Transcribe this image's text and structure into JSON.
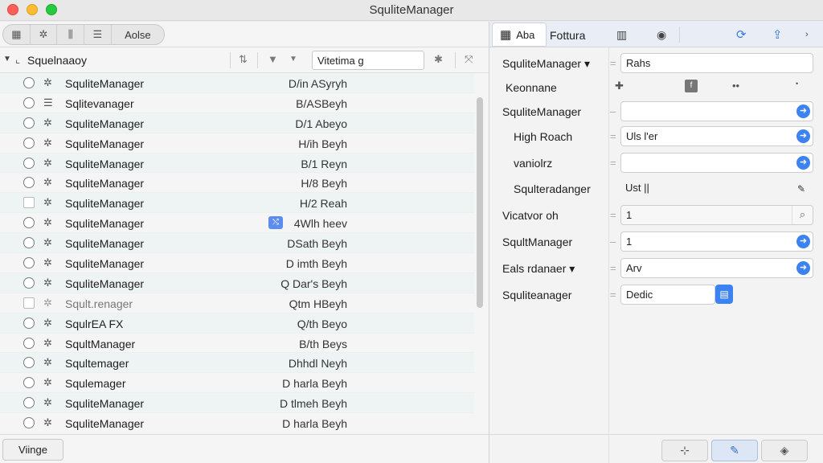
{
  "window": {
    "title": "SquliteManager"
  },
  "left_toolbar": {
    "buttons": [
      {
        "icon": "database-icon",
        "glyph": "▦"
      },
      {
        "icon": "tools-icon",
        "glyph": "✲"
      },
      {
        "icon": "columns-icon",
        "glyph": "⫼"
      },
      {
        "icon": "list-icon",
        "glyph": "☰"
      }
    ],
    "label": "Aolse"
  },
  "tree_header": {
    "label": "Squelnaaoy",
    "search_value": "Vitetima g"
  },
  "rows": [
    {
      "name": "SquliteManager",
      "value": "D/in ASyryh"
    },
    {
      "name": "Sqlitevanager",
      "value": "B/ASBeyh"
    },
    {
      "name": "SquliteManager",
      "value": "D/1 Abeyo"
    },
    {
      "name": "SquliteManager",
      "value": "H/ih Beyh"
    },
    {
      "name": "SquliteManager",
      "value": "B/1 Reyn"
    },
    {
      "name": "SquliteManager",
      "value": "H/8 Beyh"
    },
    {
      "name": "SquliteManager",
      "value": "H/2 Reah"
    },
    {
      "name": "SquliteManager",
      "value": "4Wlh heev"
    },
    {
      "name": "SquliteManager",
      "value": "DSath Beyh"
    },
    {
      "name": "SquliteManager",
      "value": "D imth Beyh"
    },
    {
      "name": "SquliteManager",
      "value": "Q Dar's Beyh"
    },
    {
      "name": "Sqult.renager",
      "value": "Qtm HBeyh"
    },
    {
      "name": "SqulrEA FX",
      "value": "Q/th Beyo"
    },
    {
      "name": "SqultManager",
      "value": "B/th Beys"
    },
    {
      "name": "Squltemager",
      "value": "Dhhdl Neyh"
    },
    {
      "name": "Squlemager",
      "value": "D harla Beyh"
    },
    {
      "name": "SquliteManager",
      "value": "D tlmeh Beyh"
    },
    {
      "name": "SquliteManager",
      "value": "D harla Beyh"
    }
  ],
  "left_footer": {
    "button_label": "Viinge"
  },
  "right_tabs": {
    "active_label": "Aba",
    "second_label": "Fottura"
  },
  "form": {
    "items": [
      {
        "label": "SquliteManager ▾",
        "value": "Rahs"
      },
      {
        "label": "Keonnane",
        "value": ""
      },
      {
        "label": "SquliteManager",
        "value": ""
      },
      {
        "label": "High Roach",
        "value": "Uls l'er"
      },
      {
        "label": "vaniolrz",
        "value": ""
      },
      {
        "label": "Squlteradanger",
        "value": "Ust ||"
      },
      {
        "label": "Vicatvor oh",
        "value": "1"
      },
      {
        "label": "SqultManager",
        "value": "1"
      },
      {
        "label": "Eals rdanaer ▾",
        "value": "Arv"
      },
      {
        "label": "Squliteanager",
        "value": "Dedic"
      }
    ]
  }
}
